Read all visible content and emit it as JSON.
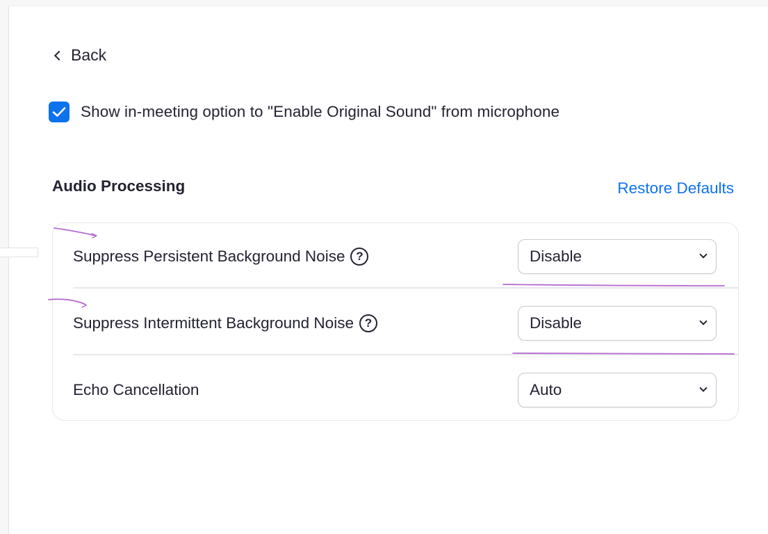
{
  "back": {
    "label": "Back",
    "icon": "chevron-left-icon"
  },
  "original_sound": {
    "checked": true,
    "label": "Show in-meeting option to \"Enable Original Sound\" from microphone"
  },
  "audio_processing": {
    "title": "Audio Processing",
    "restore_label": "Restore Defaults",
    "rows": [
      {
        "label": "Suppress Persistent Background Noise",
        "help": "?",
        "value": "Disable"
      },
      {
        "label": "Suppress Intermittent Background Noise",
        "help": "?",
        "value": "Disable"
      },
      {
        "label": "Echo Cancellation",
        "value": "Auto"
      }
    ]
  },
  "colors": {
    "accent": "#0e72ed",
    "text": "#232333",
    "annotation": "#b66bd0"
  }
}
